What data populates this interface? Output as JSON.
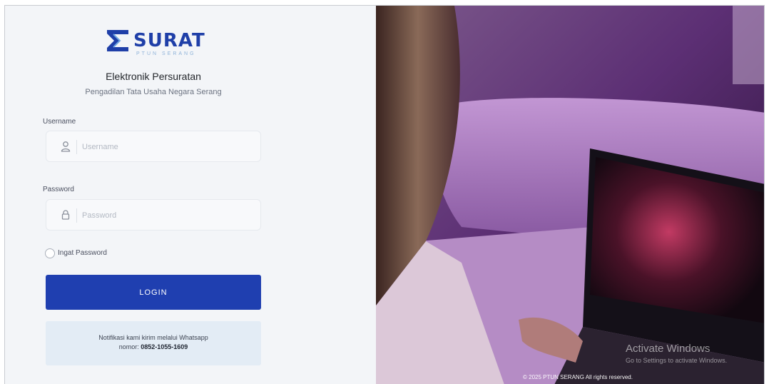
{
  "brand": {
    "name": "SURAT",
    "tagline": "PTUN SERANG",
    "logo_color": "#1f3fa8"
  },
  "header": {
    "title": "Elektronik Persuratan",
    "subtitle": "Pengadilan Tata Usaha Negara Serang"
  },
  "form": {
    "username_label": "Username",
    "username_placeholder": "Username",
    "username_icon": "user-icon",
    "password_label": "Password",
    "password_placeholder": "Password",
    "password_icon": "lock-icon",
    "remember_label": "Ingat Password",
    "login_label": "LOGIN",
    "login_color": "#1f3fb0"
  },
  "notice": {
    "line1": "Notifikasi kami kirim melalui Whatsapp",
    "line2_prefix": "nomor:",
    "phone": "0852-1055-1609"
  },
  "hero": {
    "watermark_title": "Activate Windows",
    "watermark_sub": "Go to Settings to activate Windows.",
    "copyright": "© 2025 PTUN SERANG All rights reserved."
  }
}
